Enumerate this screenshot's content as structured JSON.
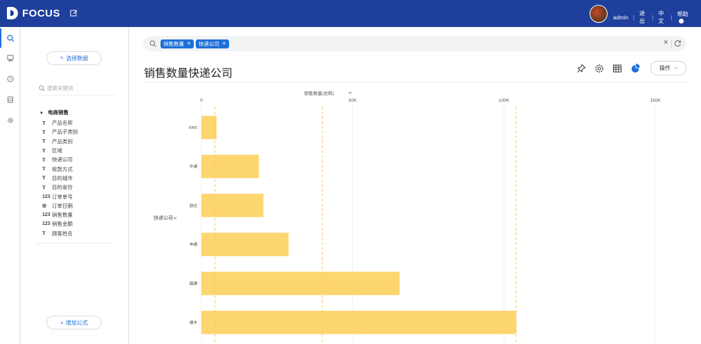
{
  "topbar": {
    "logo_text": "FOCUS",
    "user": "admin",
    "logout": "退出",
    "language": "中文",
    "help": "帮助"
  },
  "rail": {
    "icons": [
      "search-icon",
      "bookmark-icon",
      "question-icon",
      "database-icon",
      "gear-icon"
    ]
  },
  "sidebar": {
    "select_data_label": "选择数据",
    "select_data_icon": "back-arrow-icon",
    "search_placeholder": "搜索关键词",
    "dataset_name": "电商销售",
    "fields": [
      {
        "type": "T",
        "name": "产品名称"
      },
      {
        "type": "T",
        "name": "产品子类别"
      },
      {
        "type": "T",
        "name": "产品类别"
      },
      {
        "type": "T",
        "name": "区域"
      },
      {
        "type": "T",
        "name": "快递公司"
      },
      {
        "type": "T",
        "name": "收款方式"
      },
      {
        "type": "T",
        "name": "目的城市"
      },
      {
        "type": "T",
        "name": "目的省份"
      },
      {
        "type": "123",
        "name": "订单单号"
      },
      {
        "type": "date",
        "name": "订单日期"
      },
      {
        "type": "123",
        "name": "销售数量"
      },
      {
        "type": "123",
        "name": "销售金额"
      },
      {
        "type": "T",
        "name": "顾客姓名"
      }
    ],
    "add_formula_label": "增加公式"
  },
  "searchbar": {
    "tokens": [
      "销售数量",
      "快递公司"
    ]
  },
  "main": {
    "title": "销售数量快递公司",
    "operate_label": "操作",
    "tools": [
      "pin-icon",
      "gear-icon",
      "table-icon",
      "pie-chart-icon"
    ]
  },
  "chart_data": {
    "type": "bar",
    "orientation": "horizontal",
    "title": "销售数量(总和)",
    "ylabel": "快递公司",
    "categories": [
      "EMS",
      "中通",
      "韵达",
      "申通",
      "圆通",
      "顺丰"
    ],
    "values": [
      5000,
      19000,
      20500,
      28800,
      65500,
      104000
    ],
    "xlim": [
      0,
      150000
    ],
    "xticks": [
      0,
      50000,
      100000,
      150000
    ],
    "xtick_labels": [
      "0",
      "50K",
      "100K",
      "150K"
    ],
    "bar_color": "#fdd670",
    "reference_lines": [
      4500,
      40000,
      104000
    ],
    "reference_color": "#f6c96a"
  }
}
